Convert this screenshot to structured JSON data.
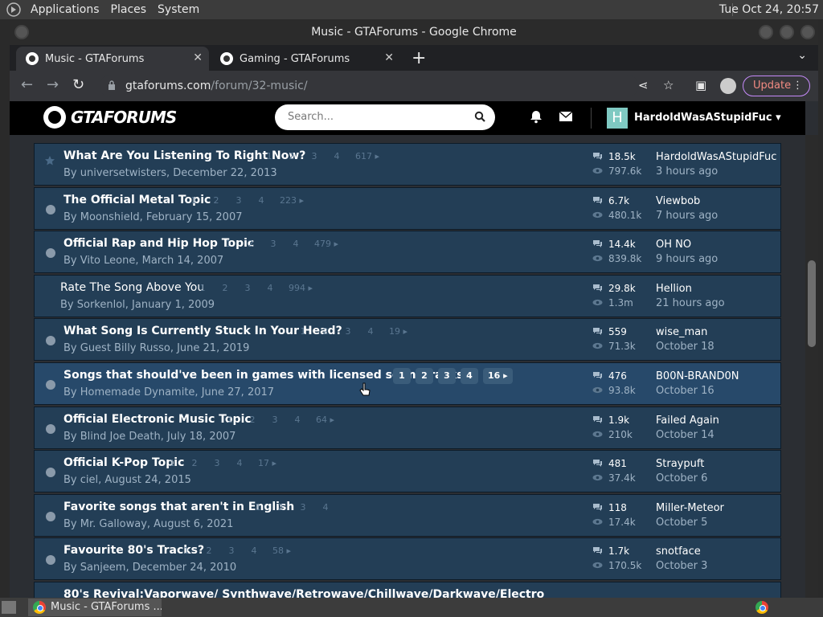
{
  "panel": {
    "menus": [
      "Applications",
      "Places",
      "System"
    ],
    "clock": "Tue Oct 24, 20:57"
  },
  "window": {
    "title": "Music - GTAForums - Google Chrome",
    "tabs": [
      {
        "label": "Music - GTAForums",
        "active": true
      },
      {
        "label": "Gaming - GTAForums",
        "active": false
      }
    ],
    "url_host": "gtaforums.com",
    "url_path": "/forum/32-music/",
    "update_label": "Update"
  },
  "site": {
    "logo_text": "GTAFORUMS",
    "search_placeholder": "Search...",
    "user_initial": "H",
    "username": "HardoldWasAStupidFuc"
  },
  "topics": [
    {
      "title": "What Are You Listening To Right Now?",
      "author_line": "By universetwisters, December 22, 2013",
      "pages": [
        "1",
        "2",
        "3",
        "4",
        "617"
      ],
      "replies": "18.5k",
      "views": "797.6k",
      "last_user": "HardoldWasAStupidFuc",
      "last_time": "3 hours ago",
      "icon": "star",
      "bold": true
    },
    {
      "title": "The Official Metal Topic",
      "author_line": "By Moonshield, February 15, 2007",
      "pages": [
        "1",
        "2",
        "3",
        "4",
        "223"
      ],
      "replies": "6.7k",
      "views": "480.1k",
      "last_user": "Viewbob",
      "last_time": "7 hours ago",
      "icon": "dot",
      "bold": true
    },
    {
      "title": "Official Rap and Hip Hop Topic",
      "author_line": "By Vito Leone, March 14, 2007",
      "pages": [
        "1",
        "2",
        "3",
        "4",
        "479"
      ],
      "replies": "14.4k",
      "views": "839.8k",
      "last_user": "OH NO",
      "last_time": "9 hours ago",
      "icon": "dot",
      "bold": true
    },
    {
      "title": "Rate The Song Above You",
      "author_line": "By Sorkenlol, January 1, 2009",
      "pages": [
        "1",
        "2",
        "3",
        "4",
        "994"
      ],
      "replies": "29.8k",
      "views": "1.3m",
      "last_user": "Hellion",
      "last_time": "21 hours ago",
      "icon": "none",
      "bold": false
    },
    {
      "title": "What Song Is Currently Stuck In Your Head?",
      "author_line": "By Guest Billy Russo, June 21, 2019",
      "pages": [
        "1",
        "2",
        "3",
        "4",
        "19"
      ],
      "replies": "559",
      "views": "71.3k",
      "last_user": "wise_man",
      "last_time": "October 18",
      "icon": "dot",
      "bold": true
    },
    {
      "title": "Songs that should've been in games with licensed soundtracks",
      "author_line": "By Homemade Dynamite, June 27, 2017",
      "pages": [
        "1",
        "2",
        "3",
        "4",
        "16"
      ],
      "replies": "476",
      "views": "93.8k",
      "last_user": "B00N-BRAND0N",
      "last_time": "October 16",
      "icon": "dot",
      "bold": true,
      "highlight": true
    },
    {
      "title": "Official Electronic Music Topic",
      "author_line": "By Blind Joe Death, July 18, 2007",
      "pages": [
        "1",
        "2",
        "3",
        "4",
        "64"
      ],
      "replies": "1.9k",
      "views": "210k",
      "last_user": "Failed Again",
      "last_time": "October 14",
      "icon": "dot",
      "bold": true
    },
    {
      "title": "Official K-Pop Topic",
      "author_line": "By ciel, August 24, 2015",
      "pages": [
        "1",
        "2",
        "3",
        "4",
        "17"
      ],
      "replies": "481",
      "views": "37.4k",
      "last_user": "Straypuft",
      "last_time": "October 6",
      "icon": "dot",
      "bold": true
    },
    {
      "title": "Favorite songs that aren't in English",
      "author_line": "By Mr. Galloway, August 6, 2021",
      "pages": [
        "1",
        "2",
        "3",
        "4"
      ],
      "replies": "118",
      "views": "17.4k",
      "last_user": "Miller-Meteor",
      "last_time": "October 5",
      "icon": "dot",
      "bold": true
    },
    {
      "title": "Favourite 80's Tracks?",
      "author_line": "By Sanjeem, December 24, 2010",
      "pages": [
        "1",
        "2",
        "3",
        "4",
        "58"
      ],
      "replies": "1.7k",
      "views": "170.5k",
      "last_user": "snotface",
      "last_time": "October 3",
      "icon": "dot",
      "bold": true
    },
    {
      "title": "80's Revival:Vaporwave/ Synthwave/Retrowave/Chillwave/Darkwave/Electro",
      "author_line": "",
      "pages": [],
      "replies": "",
      "views": "",
      "last_user": "",
      "last_time": "",
      "icon": "dot",
      "bold": true
    }
  ],
  "taskbar": {
    "item_label": "Music - GTAForums ..."
  }
}
